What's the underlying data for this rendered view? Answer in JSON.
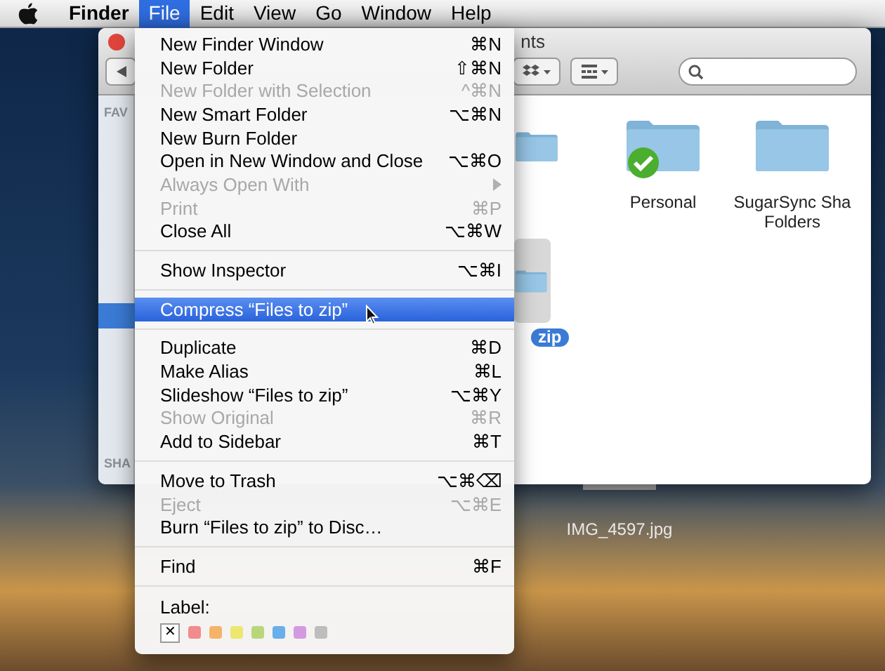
{
  "menu_bar": {
    "items": [
      {
        "label": "Finder",
        "kind": "app",
        "selected": false
      },
      {
        "label": "File",
        "kind": "menu",
        "selected": true
      },
      {
        "label": "Edit",
        "kind": "menu",
        "selected": false
      },
      {
        "label": "View",
        "kind": "menu",
        "selected": false
      },
      {
        "label": "Go",
        "kind": "menu",
        "selected": false
      },
      {
        "label": "Window",
        "kind": "menu",
        "selected": false
      },
      {
        "label": "Help",
        "kind": "menu",
        "selected": false
      }
    ]
  },
  "finder_window": {
    "title": "nts",
    "sidebar": {
      "sections": [
        "FAV",
        "SHA"
      ]
    },
    "files": [
      {
        "label": "Personal",
        "synced": true,
        "selected": false
      },
      {
        "label": "SugarSync Sha\nFolders",
        "synced": false,
        "selected": false
      }
    ],
    "selected_item": {
      "label": "zip",
      "selected": true
    }
  },
  "desktop": {
    "files": [
      {
        "label": "IMG_4597.jpg"
      }
    ]
  },
  "file_menu": {
    "items": [
      {
        "kind": "item",
        "label": "New Finder Window",
        "shortcut": "⌘N",
        "disabled": false,
        "selected": false
      },
      {
        "kind": "item",
        "label": "New Folder",
        "shortcut": "⇧⌘N",
        "disabled": false,
        "selected": false
      },
      {
        "kind": "item",
        "label": "New Folder with Selection",
        "shortcut": "^⌘N",
        "disabled": true,
        "selected": false
      },
      {
        "kind": "item",
        "label": "New Smart Folder",
        "shortcut": "⌥⌘N",
        "disabled": false,
        "selected": false
      },
      {
        "kind": "item",
        "label": "New Burn Folder",
        "disabled": false,
        "selected": false
      },
      {
        "kind": "item",
        "label": "Open in New Window and Close",
        "shortcut": "⌥⌘O",
        "disabled": false,
        "selected": false
      },
      {
        "kind": "submenu",
        "label": "Always Open With",
        "disabled": true,
        "selected": false
      },
      {
        "kind": "item",
        "label": "Print",
        "shortcut": "⌘P",
        "disabled": true,
        "selected": false
      },
      {
        "kind": "item",
        "label": "Close All",
        "shortcut": "⌥⌘W",
        "disabled": false,
        "selected": false
      },
      {
        "kind": "separator"
      },
      {
        "kind": "item",
        "label": "Show Inspector",
        "shortcut": "⌥⌘I",
        "disabled": false,
        "selected": false
      },
      {
        "kind": "separator"
      },
      {
        "kind": "item",
        "label": "Compress “Files to zip”",
        "disabled": false,
        "selected": true
      },
      {
        "kind": "separator"
      },
      {
        "kind": "item",
        "label": "Duplicate",
        "shortcut": "⌘D",
        "disabled": false,
        "selected": false
      },
      {
        "kind": "item",
        "label": "Make Alias",
        "shortcut": "⌘L",
        "disabled": false,
        "selected": false
      },
      {
        "kind": "item",
        "label": "Slideshow “Files to zip”",
        "shortcut": "⌥⌘Y",
        "disabled": false,
        "selected": false
      },
      {
        "kind": "item",
        "label": "Show Original",
        "shortcut": "⌘R",
        "disabled": true,
        "selected": false
      },
      {
        "kind": "item",
        "label": "Add to Sidebar",
        "shortcut": "⌘T",
        "disabled": false,
        "selected": false
      },
      {
        "kind": "separator"
      },
      {
        "kind": "item",
        "label": "Move to Trash",
        "shortcut": "⌥⌘⌫",
        "disabled": false,
        "selected": false
      },
      {
        "kind": "item",
        "label": "Eject",
        "shortcut": "⌥⌘E",
        "disabled": true,
        "selected": false
      },
      {
        "kind": "item",
        "label": "Burn “Files to zip” to Disc…",
        "disabled": false,
        "selected": false
      },
      {
        "kind": "separator"
      },
      {
        "kind": "item",
        "label": "Find",
        "shortcut": "⌘F",
        "disabled": false,
        "selected": false
      },
      {
        "kind": "separator"
      },
      {
        "kind": "labels",
        "label": "Label:",
        "colors": [
          {
            "color": "#ffffff",
            "kind": "none",
            "glyph": "✕"
          },
          {
            "color": "#f28b8b",
            "kind": "swatch"
          },
          {
            "color": "#f5b36a",
            "kind": "swatch"
          },
          {
            "color": "#ede66f",
            "kind": "swatch"
          },
          {
            "color": "#b9d77a",
            "kind": "swatch"
          },
          {
            "color": "#6aaeea",
            "kind": "swatch"
          },
          {
            "color": "#d49ae0",
            "kind": "swatch"
          },
          {
            "color": "#bdbdbd",
            "kind": "swatch"
          }
        ]
      }
    ]
  }
}
